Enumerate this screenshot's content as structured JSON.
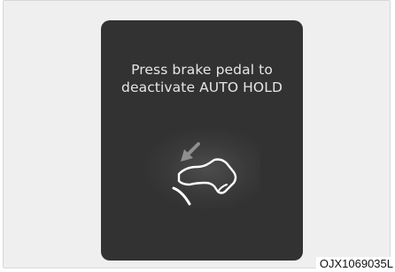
{
  "display": {
    "message_line1": "Press brake pedal to",
    "message_line2": "deactivate AUTO HOLD",
    "icon": "brake-pedal-press-icon"
  },
  "figure_code": "OJX1069035L",
  "colors": {
    "background": "#efefef",
    "panel": "#323232",
    "text": "#e6e6e6",
    "icon_white": "#ffffff",
    "arrow_gray": "#8f8f8f"
  }
}
